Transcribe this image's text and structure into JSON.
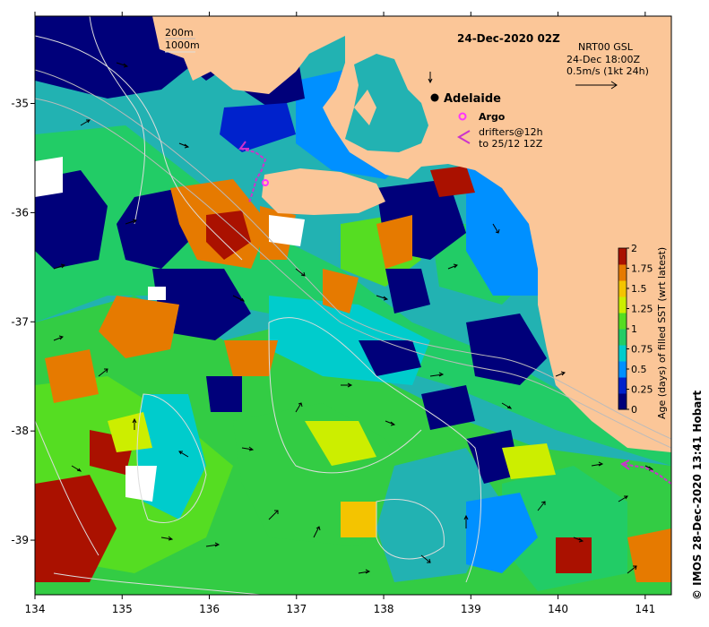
{
  "map": {
    "title": "24-Dec-2020 02Z",
    "product_line1": "NRT00 GSL",
    "product_line2": "24-Dec 18:00Z",
    "product_line3": "0.5m/s (1kt 24h)",
    "city_label": "Adelaide",
    "argo_label": "Argo",
    "drifters_line1": "drifters@12h",
    "drifters_line2": "to 25/12 12Z",
    "contour_200_label": "200m",
    "contour_1000_label": "1000m",
    "credit": "© IMOS 28-Dec-2020 13:41 Hobart",
    "colors": {
      "land": "#fbc698",
      "sea_base": "#22b2b2",
      "argo": "#ff33ff",
      "drifters": "#cc33cc"
    }
  },
  "x_axis": {
    "ticks": [
      "134",
      "135",
      "136",
      "137",
      "138",
      "139",
      "140",
      "141"
    ]
  },
  "y_axis": {
    "ticks": [
      "-35",
      "-36",
      "-37",
      "-38",
      "-39"
    ]
  },
  "colorbar": {
    "label": "Age (days) of filled SST (wrt latest)",
    "ticks": [
      "0",
      "0.25",
      "0.5",
      "0.75",
      "1",
      "1.25",
      "1.5",
      "1.75",
      "2"
    ],
    "colors": [
      "#00007a",
      "#0022cc",
      "#0090ff",
      "#00cccc",
      "#22cc66",
      "#55dd22",
      "#ccee00",
      "#f4c400",
      "#e67a00",
      "#aa1100"
    ]
  },
  "chart_data": {
    "type": "heatmap",
    "title": "24-Dec-2020 02Z",
    "xlabel": "",
    "ylabel": "",
    "xlim": [
      134,
      141.3
    ],
    "ylim": [
      -39.5,
      -34.2
    ],
    "x_ticks": [
      134,
      135,
      136,
      137,
      138,
      139,
      140,
      141
    ],
    "y_ticks": [
      -35,
      -36,
      -37,
      -38,
      -39
    ],
    "colorbar_range": [
      0,
      2
    ],
    "colorbar_label": "Age (days) of filled SST (wrt latest)",
    "points": [
      {
        "name": "Adelaide",
        "lon": 138.6,
        "lat": -34.93
      }
    ]
  }
}
